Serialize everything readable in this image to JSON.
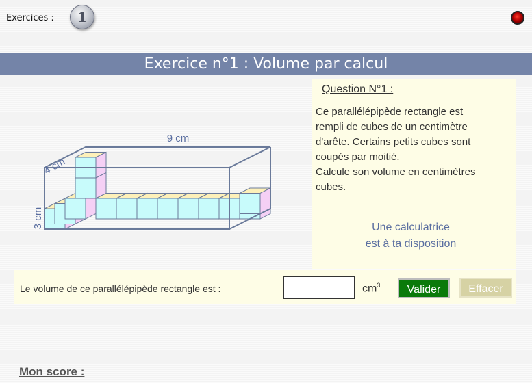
{
  "header": {
    "exercises_label": "Exercices :",
    "exercise_number": "1"
  },
  "title": "Exercice n°1 : Volume par calcul",
  "diagram": {
    "length_label": "9 cm",
    "depth_label": "4 cm",
    "height_label": "3 cm",
    "colors": {
      "front": "#c8fbfb",
      "top": "#fdf0b9",
      "side": "#f5d0f5",
      "edge": "#6a7a9a"
    }
  },
  "question": {
    "title": "Question N°1 :",
    "lines": [
      "Ce parallélépipède rectangle est",
      "rempli de cubes de un centimètre",
      "d'arête. Certains petits cubes sont",
      "coupés par moitié.",
      "Calcule son volume en centimètres",
      "cubes."
    ],
    "calculator_lines": [
      "Une  calculatrice",
      "est à ta disposition"
    ]
  },
  "answer": {
    "label": "Le volume de ce parallélépipède rectangle  est :",
    "value": "",
    "unit": "cm",
    "unit_exponent": "3",
    "validate_label": "Valider",
    "clear_label": "Effacer"
  },
  "score": {
    "label": "Mon score :"
  }
}
